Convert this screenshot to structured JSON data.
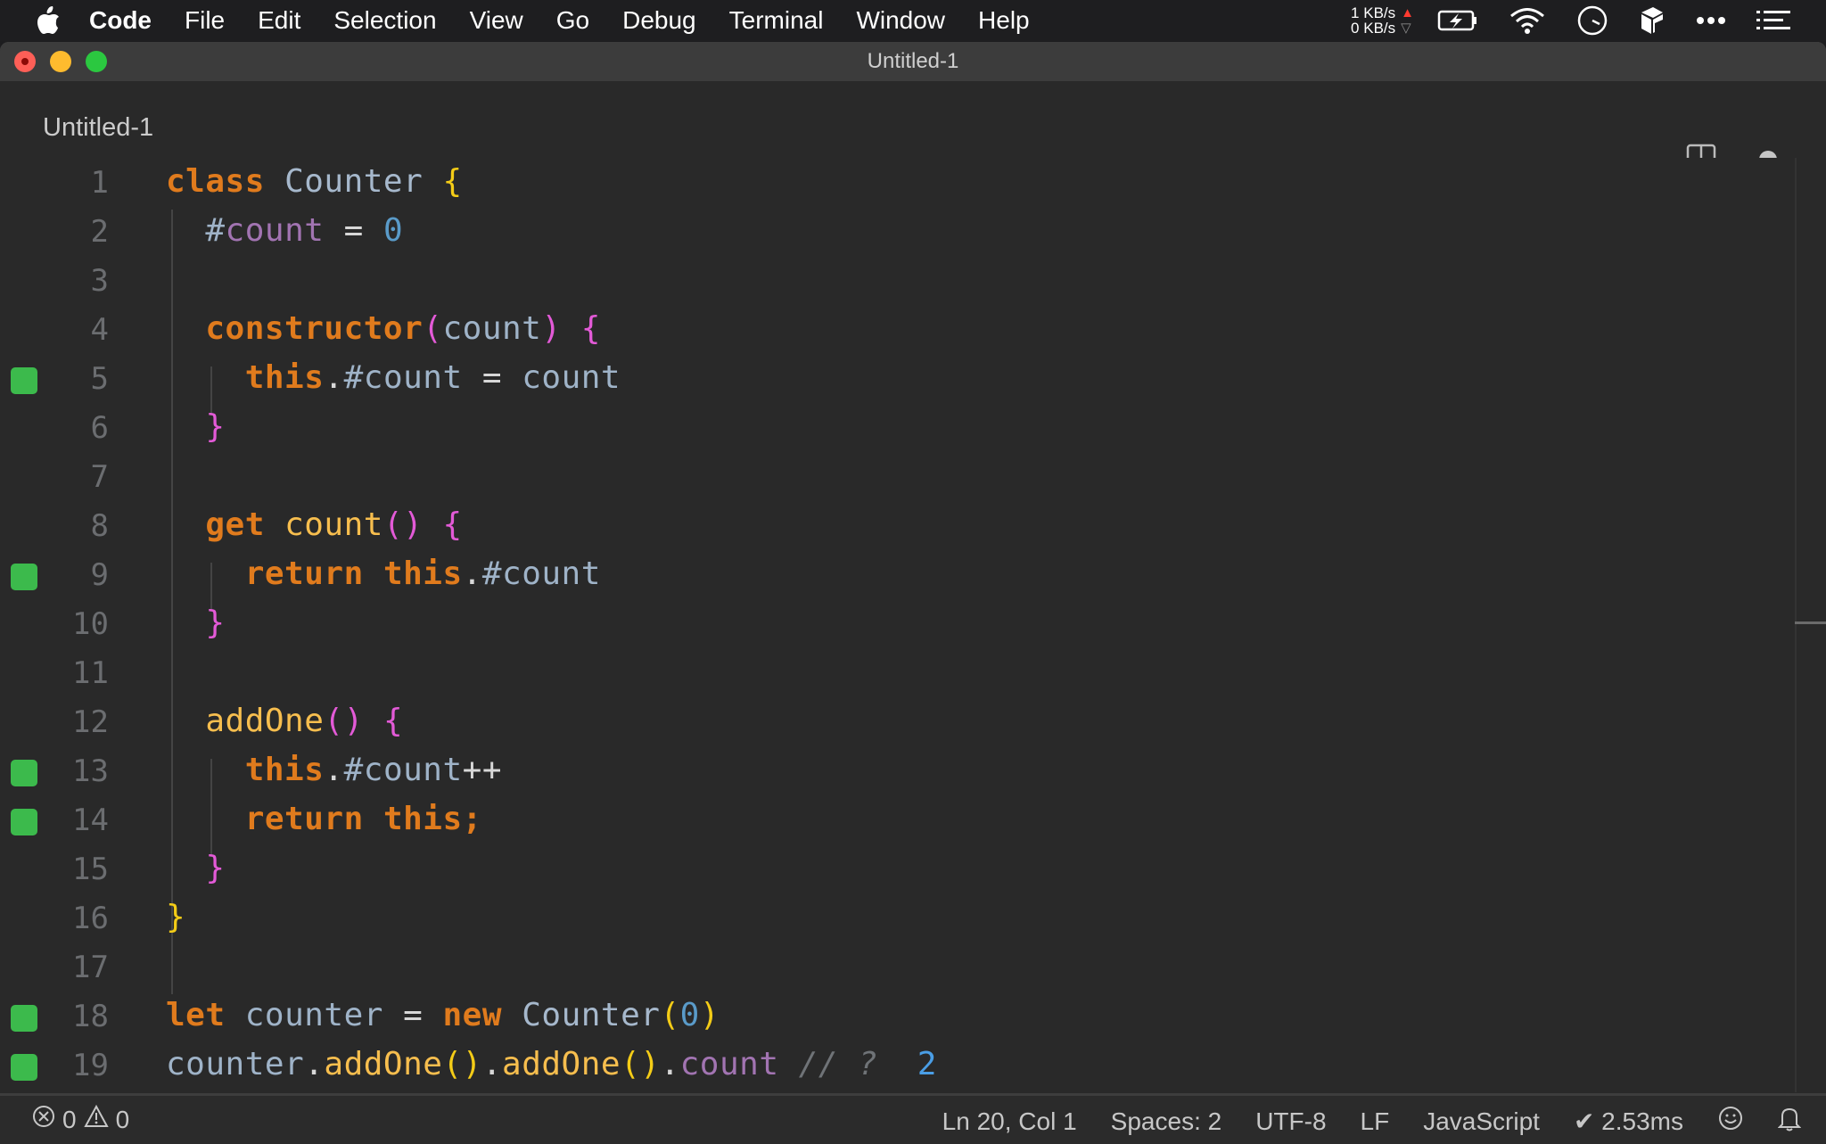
{
  "menubar": {
    "apple_icon": "apple-logo",
    "app_name": "Code",
    "items": [
      "File",
      "Edit",
      "Selection",
      "View",
      "Go",
      "Debug",
      "Terminal",
      "Window",
      "Help"
    ],
    "net_up": "1 KB/s",
    "net_down": "0 KB/s",
    "tray_icons": [
      "battery-charging-icon",
      "wifi-icon",
      "clock-icon",
      "box-icon",
      "more-icon",
      "list-icon"
    ]
  },
  "window": {
    "title": "Untitled-1"
  },
  "tabbar": {
    "tab_label": "Untitled-1",
    "split_icon": "split-editor-icon",
    "dirty_indicator": "unsaved-dot"
  },
  "editor": {
    "language": "JavaScript",
    "lines": [
      {
        "n": "1",
        "mark": false
      },
      {
        "n": "2",
        "mark": false
      },
      {
        "n": "3",
        "mark": false
      },
      {
        "n": "4",
        "mark": false
      },
      {
        "n": "5",
        "mark": true
      },
      {
        "n": "6",
        "mark": false
      },
      {
        "n": "7",
        "mark": false
      },
      {
        "n": "8",
        "mark": false
      },
      {
        "n": "9",
        "mark": true
      },
      {
        "n": "10",
        "mark": false
      },
      {
        "n": "11",
        "mark": false
      },
      {
        "n": "12",
        "mark": false
      },
      {
        "n": "13",
        "mark": true
      },
      {
        "n": "14",
        "mark": true
      },
      {
        "n": "15",
        "mark": false
      },
      {
        "n": "16",
        "mark": false
      },
      {
        "n": "17",
        "mark": false
      },
      {
        "n": "18",
        "mark": true
      },
      {
        "n": "19",
        "mark": true
      }
    ],
    "tokens": {
      "class_kw": "class",
      "class_name": "Counter",
      "open_brace": "{",
      "close_brace": "}",
      "hash": "#",
      "count": "count",
      "eq": "=",
      "zero": "0",
      "constructor": "constructor",
      "lparen": "(",
      "rparen": ")",
      "this": "this",
      "dot": ".",
      "get": "get",
      "return": "return",
      "addOne": "addOne",
      "incr": "++",
      "semi": ";",
      "let": "let",
      "counter": "counter",
      "new": "new",
      "comment": "// ?",
      "result": "2"
    }
  },
  "statusbar": {
    "errors": "0",
    "warnings": "0",
    "position": "Ln 20, Col 1",
    "spaces": "Spaces: 2",
    "encoding": "UTF-8",
    "eol": "LF",
    "language": "JavaScript",
    "timing": "✔ 2.53ms"
  }
}
